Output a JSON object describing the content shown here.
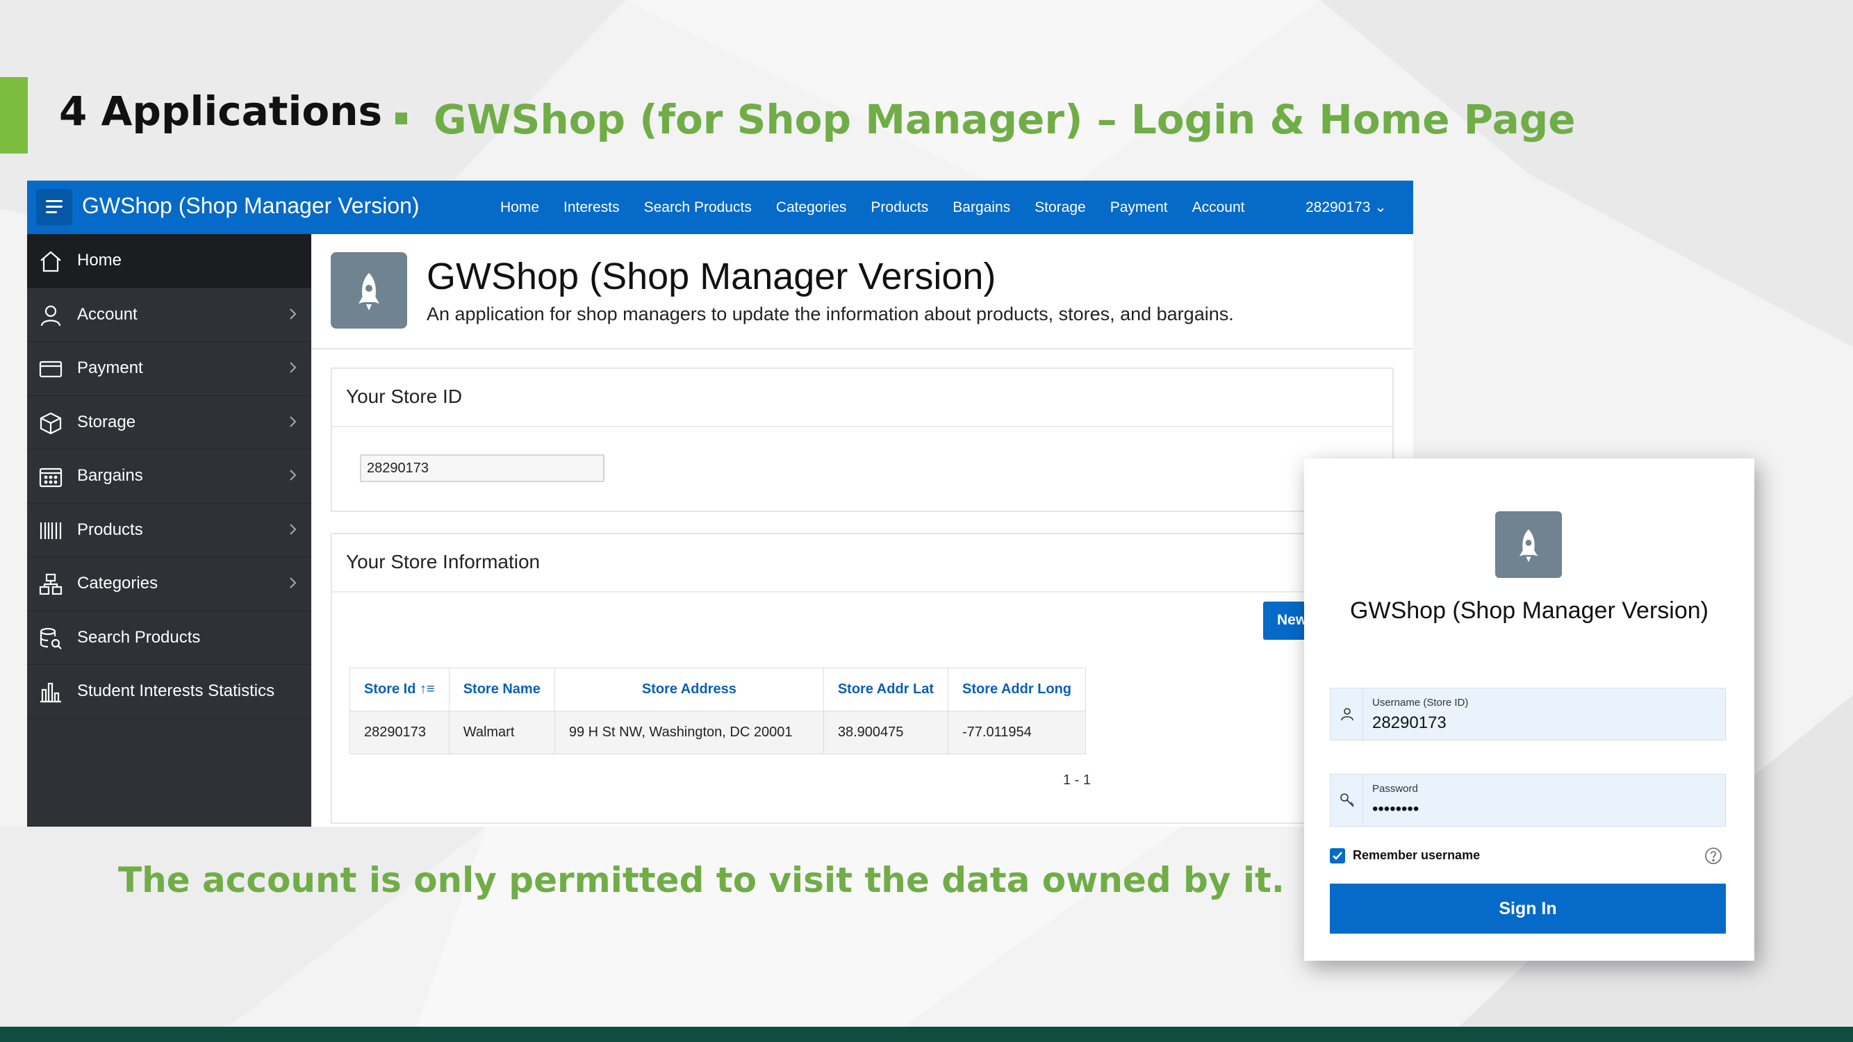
{
  "slide": {
    "title": "4 Applications",
    "subtitle": "GWShop (for Shop Manager) – Login & Home Page",
    "note": "The account is only permitted to visit the data owned by it.",
    "colors": {
      "accent_green": "#70ad47",
      "bottom_band": "#0e4d3f"
    }
  },
  "app": {
    "title": "GWShop (Shop Manager Version)",
    "nav": [
      "Home",
      "Interests",
      "Search Products",
      "Categories",
      "Products",
      "Bargains",
      "Storage",
      "Payment",
      "Account"
    ],
    "user": "28290173 ⌄",
    "colors": {
      "brand_blue": "#056ac8",
      "sidebar": "#2e3136"
    }
  },
  "sidebar": {
    "items": [
      {
        "label": "Home",
        "icon": "home-icon",
        "active": true
      },
      {
        "label": "Account",
        "icon": "user-icon",
        "chevron": true
      },
      {
        "label": "Payment",
        "icon": "credit-card-icon",
        "chevron": true
      },
      {
        "label": "Storage",
        "icon": "box-icon",
        "chevron": true
      },
      {
        "label": "Bargains",
        "icon": "calendar-icon",
        "chevron": true
      },
      {
        "label": "Products",
        "icon": "barcode-icon",
        "chevron": true
      },
      {
        "label": "Categories",
        "icon": "hierarchy-icon",
        "chevron": true
      },
      {
        "label": "Search Products",
        "icon": "database-search-icon"
      },
      {
        "label": "Student Interests Statistics",
        "icon": "bar-chart-icon"
      }
    ]
  },
  "hero": {
    "title": "GWShop (Shop Manager Version)",
    "description": "An application for shop managers to update the information about products, stores, and bargains."
  },
  "store_id_region": {
    "title": "Your Store ID",
    "value": "28290173"
  },
  "store_info_region": {
    "title": "Your Store Information",
    "new_button": "New",
    "table": {
      "headers": [
        "Store Id ↑≡",
        "Store Name",
        "Store Address",
        "Store Addr Lat",
        "Store Addr Long"
      ],
      "rows": [
        [
          "28290173",
          "Walmart",
          "99 H St NW, Washington, DC 20001",
          "38.900475",
          "-77.011954"
        ]
      ]
    },
    "pagination": "1 - 1"
  },
  "login": {
    "title": "GWShop (Shop Manager Version)",
    "username_label": "Username (Store ID)",
    "username_value": "28290173",
    "password_label": "Password",
    "password_value": "••••••••",
    "remember_label": "Remember username",
    "remember_checked": true,
    "sign_in": "Sign In"
  }
}
